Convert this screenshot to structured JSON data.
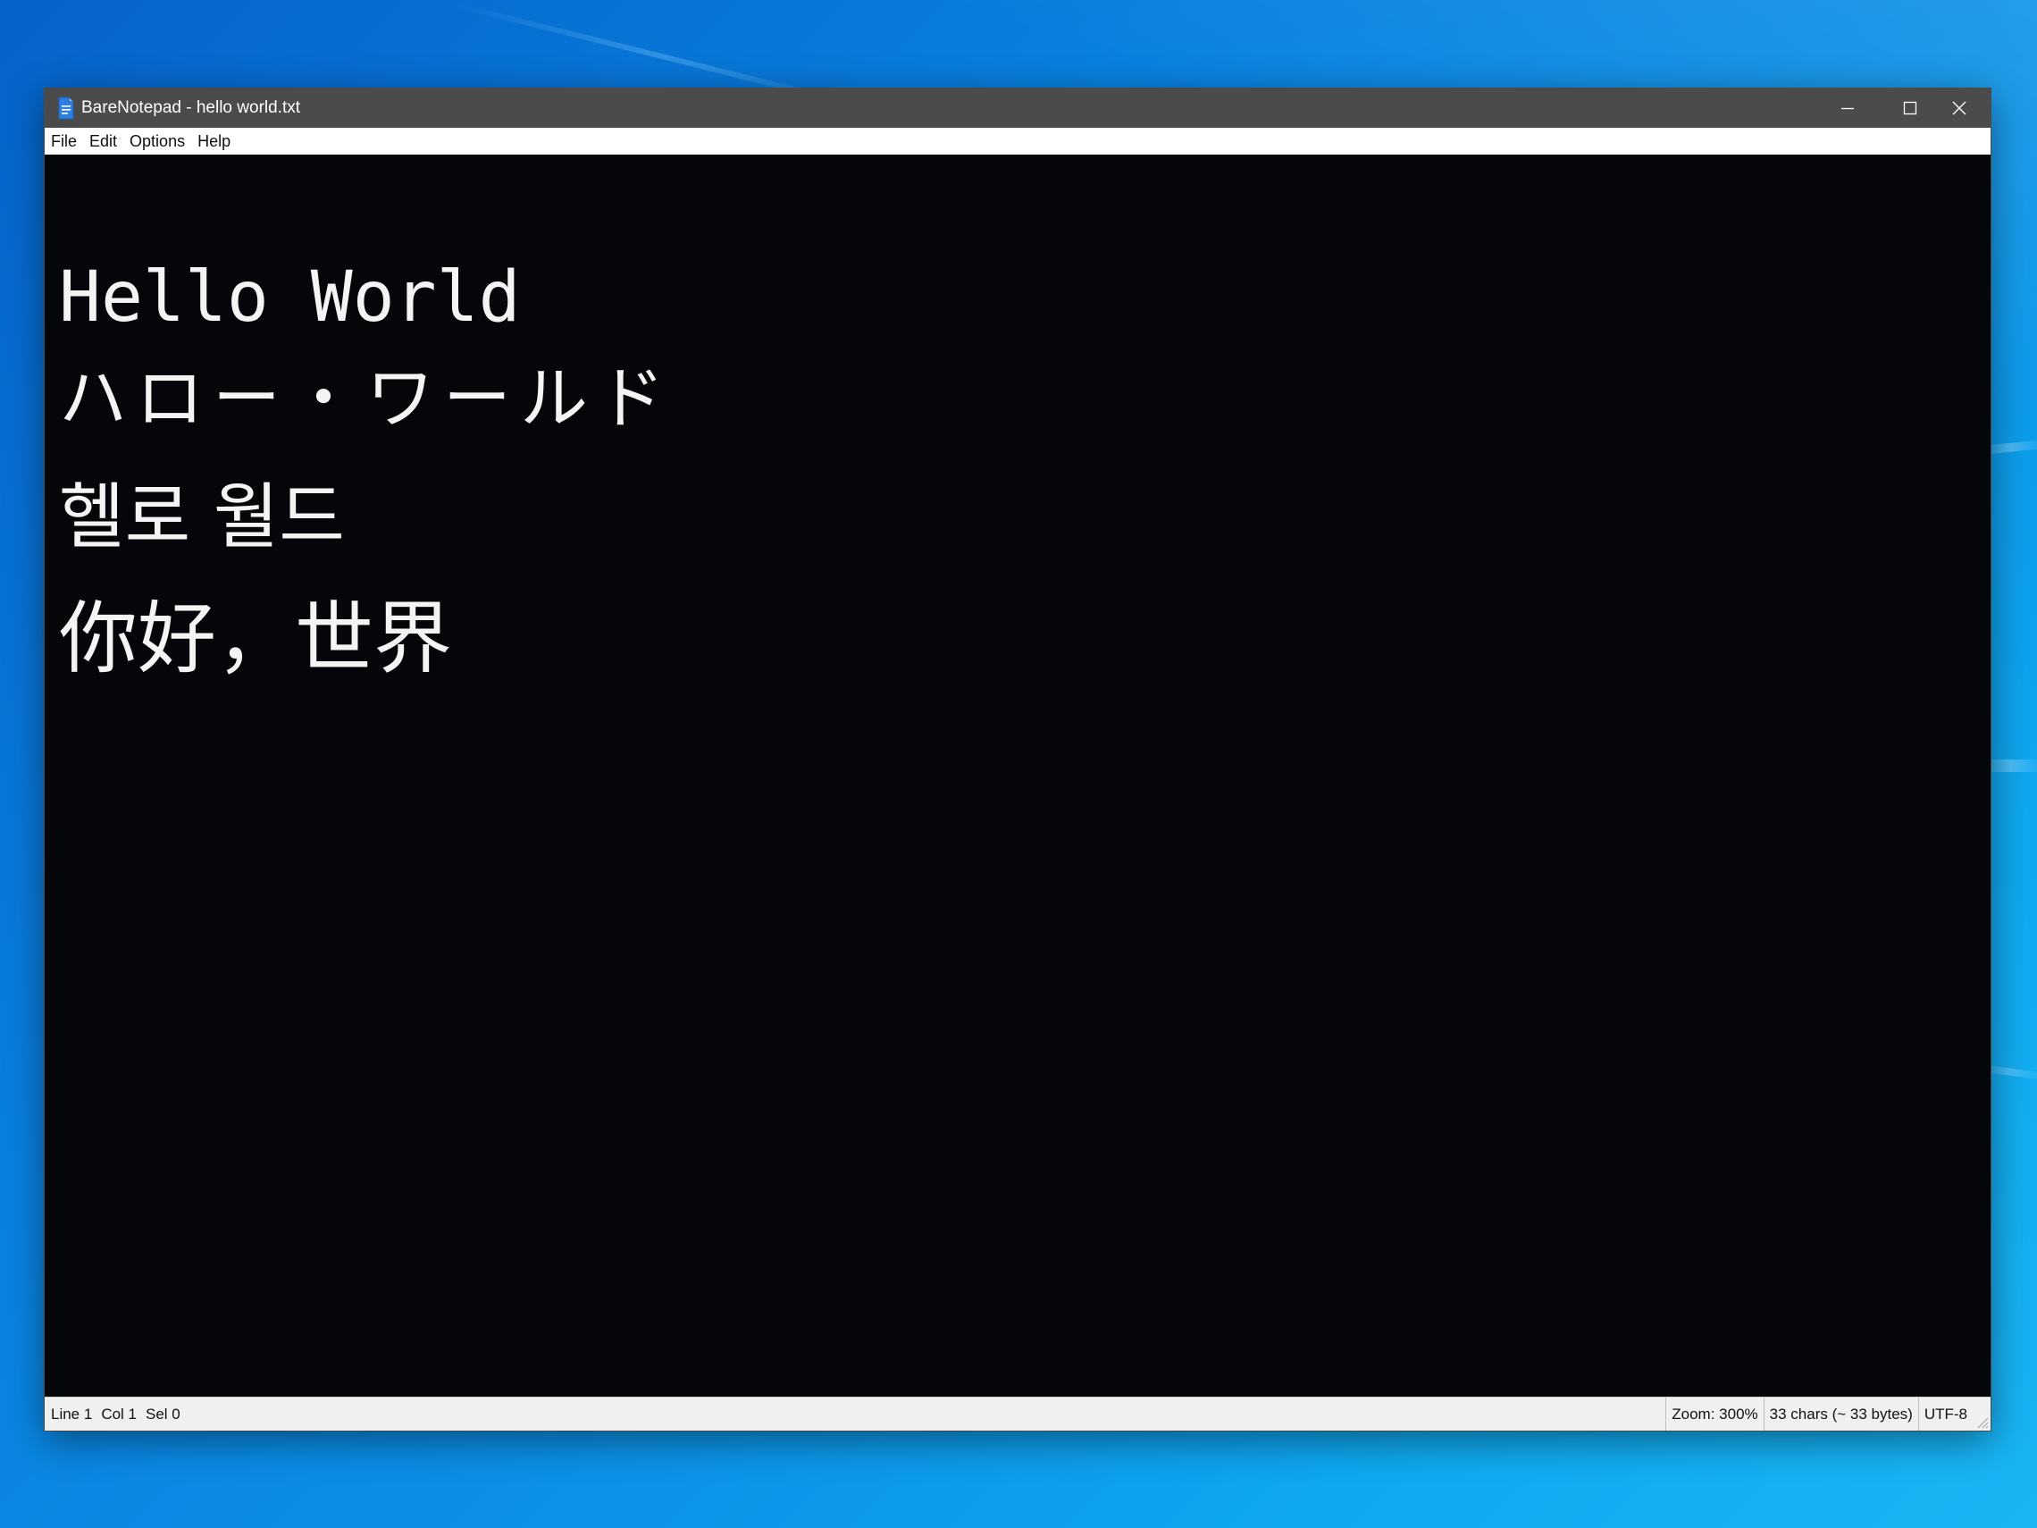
{
  "window": {
    "title": "BareNotepad - hello world.txt",
    "controls": {
      "minimize": "minimize",
      "maximize": "maximize",
      "close": "close"
    }
  },
  "menubar": {
    "items": [
      {
        "label": "File"
      },
      {
        "label": "Edit"
      },
      {
        "label": "Options"
      },
      {
        "label": "Help"
      }
    ]
  },
  "editor": {
    "lines": [
      "Hello World",
      "ハロー・ワールド",
      "헬로 월드",
      "你好，世界"
    ],
    "background_color": "#040609",
    "text_color": "#f4f4f4"
  },
  "statusbar": {
    "line": "Line 1",
    "col": "Col 1",
    "sel": "Sel 0",
    "zoom": "Zoom: 300%",
    "chars": "33 chars (~ 33 bytes)",
    "encoding": "UTF-8"
  },
  "colors": {
    "titlebar": "#4b4b4b",
    "desktop_accent": "#0a82e0"
  },
  "icons": {
    "app": "notepad-document-icon",
    "minimize": "minimize-icon",
    "maximize": "maximize-icon",
    "close": "close-icon",
    "resize": "resize-grip-icon"
  }
}
